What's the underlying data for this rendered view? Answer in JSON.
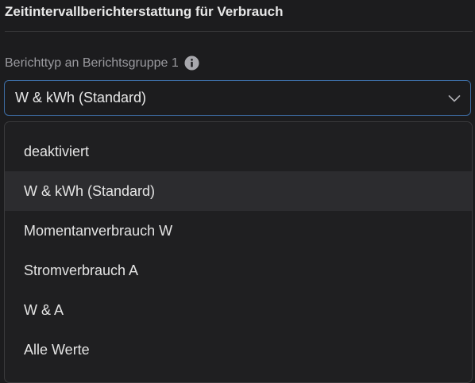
{
  "section": {
    "title": "Zeitintervallberichterstattung für Verbrauch"
  },
  "field": {
    "label": "Berichttyp an Berichtsgruppe 1",
    "info_icon": "info-icon",
    "selected_value": "W & kWh (Standard)",
    "chevron_icon": "chevron-down-icon"
  },
  "dropdown": {
    "options": [
      {
        "label": "deaktiviert",
        "selected": false
      },
      {
        "label": "W & kWh (Standard)",
        "selected": true
      },
      {
        "label": "Momentanverbrauch W",
        "selected": false
      },
      {
        "label": "Stromverbrauch A",
        "selected": false
      },
      {
        "label": "W & A",
        "selected": false
      },
      {
        "label": "Alle Werte",
        "selected": false
      }
    ]
  },
  "colors": {
    "background": "#1c1c1e",
    "focus_border": "#3d6ca3",
    "selected_option_bg": "#2c2c2f"
  }
}
